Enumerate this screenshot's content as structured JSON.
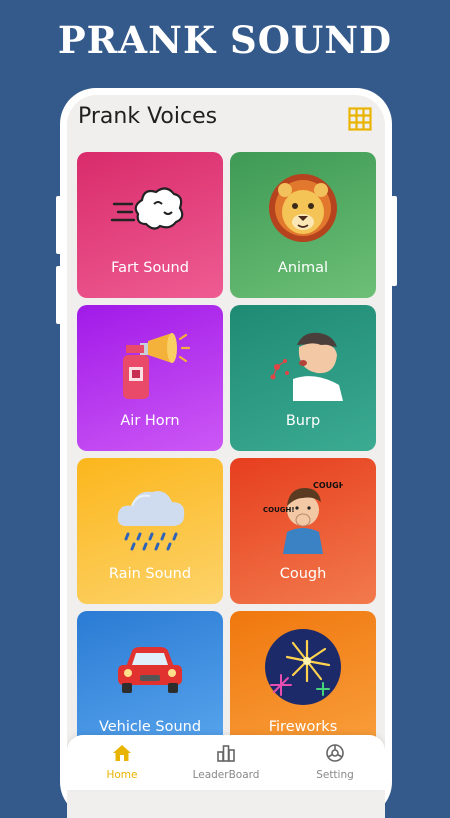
{
  "banner": {
    "title": "PRANK SOUND"
  },
  "header": {
    "title": "Prank Voices",
    "menu_icon": "grid-icon"
  },
  "colors": {
    "background": "#345a8c",
    "accent": "#e8b400"
  },
  "cards": [
    {
      "label": "Fart Sound",
      "icon": "fart-cloud-icon"
    },
    {
      "label": "Animal",
      "icon": "lion-icon"
    },
    {
      "label": "Air Horn",
      "icon": "air-horn-icon"
    },
    {
      "label": "Burp",
      "icon": "burp-person-icon"
    },
    {
      "label": "Rain Sound",
      "icon": "rain-cloud-icon"
    },
    {
      "label": "Cough",
      "icon": "cough-person-icon"
    },
    {
      "label": "Vehicle Sound",
      "icon": "car-icon"
    },
    {
      "label": "Fireworks",
      "icon": "fireworks-icon"
    }
  ],
  "nav": [
    {
      "label": "Home",
      "icon": "home-icon",
      "active": true
    },
    {
      "label": "LeaderBoard",
      "icon": "leaderboard-icon",
      "active": false
    },
    {
      "label": "Setting",
      "icon": "settings-icon",
      "active": false
    }
  ]
}
